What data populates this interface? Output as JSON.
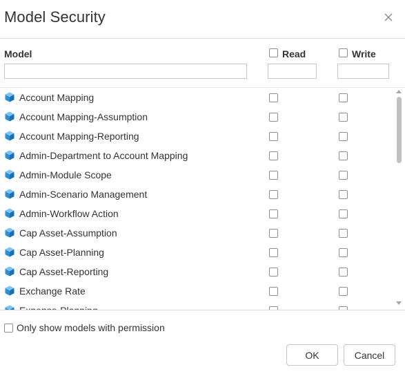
{
  "dialog": {
    "title": "Model Security",
    "close_icon": "close-icon"
  },
  "columns": {
    "model_label": "Model",
    "read_label": "Read",
    "write_label": "Write",
    "model_filter_value": "",
    "read_filter_value": "",
    "write_filter_value": ""
  },
  "models": [
    {
      "label": "Account Mapping",
      "icon": "cube-icon",
      "read": false,
      "write": false
    },
    {
      "label": "Account Mapping-Assumption",
      "icon": "cube-icon",
      "read": false,
      "write": false
    },
    {
      "label": "Account Mapping-Reporting",
      "icon": "cube-icon",
      "read": false,
      "write": false
    },
    {
      "label": "Admin-Department to Account Mapping",
      "icon": "cube-icon",
      "read": false,
      "write": false
    },
    {
      "label": "Admin-Module Scope",
      "icon": "cube-icon",
      "read": false,
      "write": false
    },
    {
      "label": "Admin-Scenario Management",
      "icon": "cube-icon",
      "read": false,
      "write": false
    },
    {
      "label": "Admin-Workflow Action",
      "icon": "cube-icon",
      "read": false,
      "write": false
    },
    {
      "label": "Cap Asset-Assumption",
      "icon": "cube-icon",
      "read": false,
      "write": false
    },
    {
      "label": "Cap Asset-Planning",
      "icon": "cube-icon",
      "read": false,
      "write": false
    },
    {
      "label": "Cap Asset-Reporting",
      "icon": "cube-icon",
      "read": false,
      "write": false
    },
    {
      "label": "Exchange Rate",
      "icon": "cube-icon",
      "read": false,
      "write": false
    },
    {
      "label": "Expense-Planning",
      "icon": "cube-icon",
      "read": false,
      "write": false
    }
  ],
  "footer": {
    "only_show_label": "Only show models with permission",
    "only_show_checked": false,
    "ok_label": "OK",
    "cancel_label": "Cancel"
  },
  "colors": {
    "cube_blue": "#2e8fd6",
    "cube_blue_dark": "#1a6fb0",
    "border": "#d9d9d9"
  }
}
